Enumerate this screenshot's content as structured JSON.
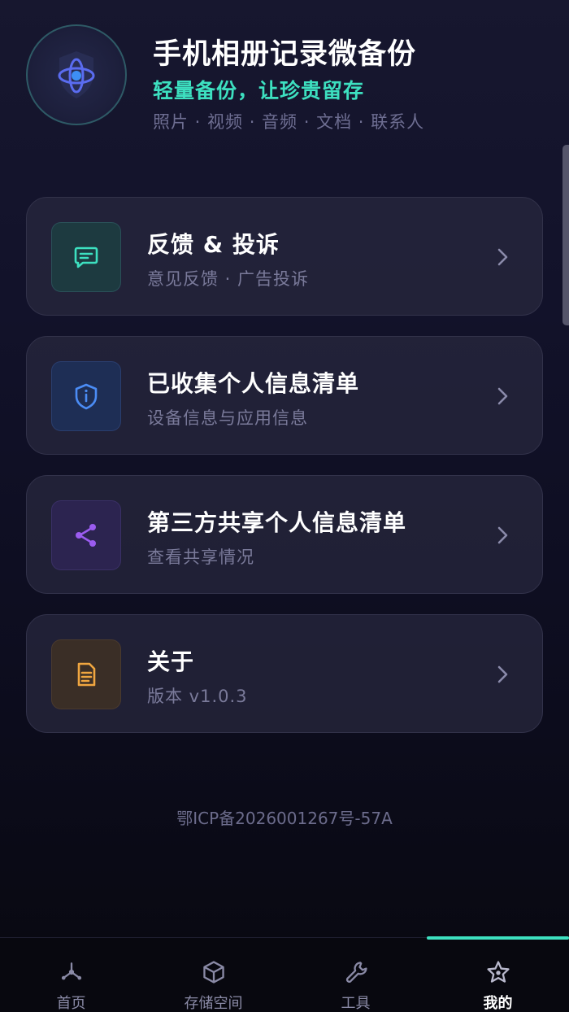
{
  "header": {
    "app_title": "手机相册记录微备份",
    "slogan": "轻量备份，让珍贵留存",
    "types": "照片 · 视频 · 音频 · 文档 · 联系人",
    "logo_icon": "orbit-planet-icon"
  },
  "menu": [
    {
      "title": "反馈 & 投诉",
      "subtitle": "意见反馈 · 广告投诉",
      "icon": "message-icon",
      "accent": "#3de0c0"
    },
    {
      "title": "已收集个人信息清单",
      "subtitle": "设备信息与应用信息",
      "icon": "shield-info-icon",
      "accent": "#4b8cf5"
    },
    {
      "title": "第三方共享个人信息清单",
      "subtitle": "查看共享情况",
      "icon": "share-icon",
      "accent": "#9b5cf0"
    },
    {
      "title": "关于",
      "subtitle": "版本 v1.0.3",
      "icon": "document-icon",
      "accent": "#f0a640"
    }
  ],
  "footer": {
    "icp": "鄂ICP备2026001267号-57A"
  },
  "bottom_nav": {
    "items": [
      {
        "label": "首页",
        "icon": "hub-icon"
      },
      {
        "label": "存储空间",
        "icon": "cube-icon"
      },
      {
        "label": "工具",
        "icon": "wrench-icon"
      },
      {
        "label": "我的",
        "icon": "star-icon"
      }
    ],
    "active_index": 3,
    "accent": "#3de0c0"
  }
}
